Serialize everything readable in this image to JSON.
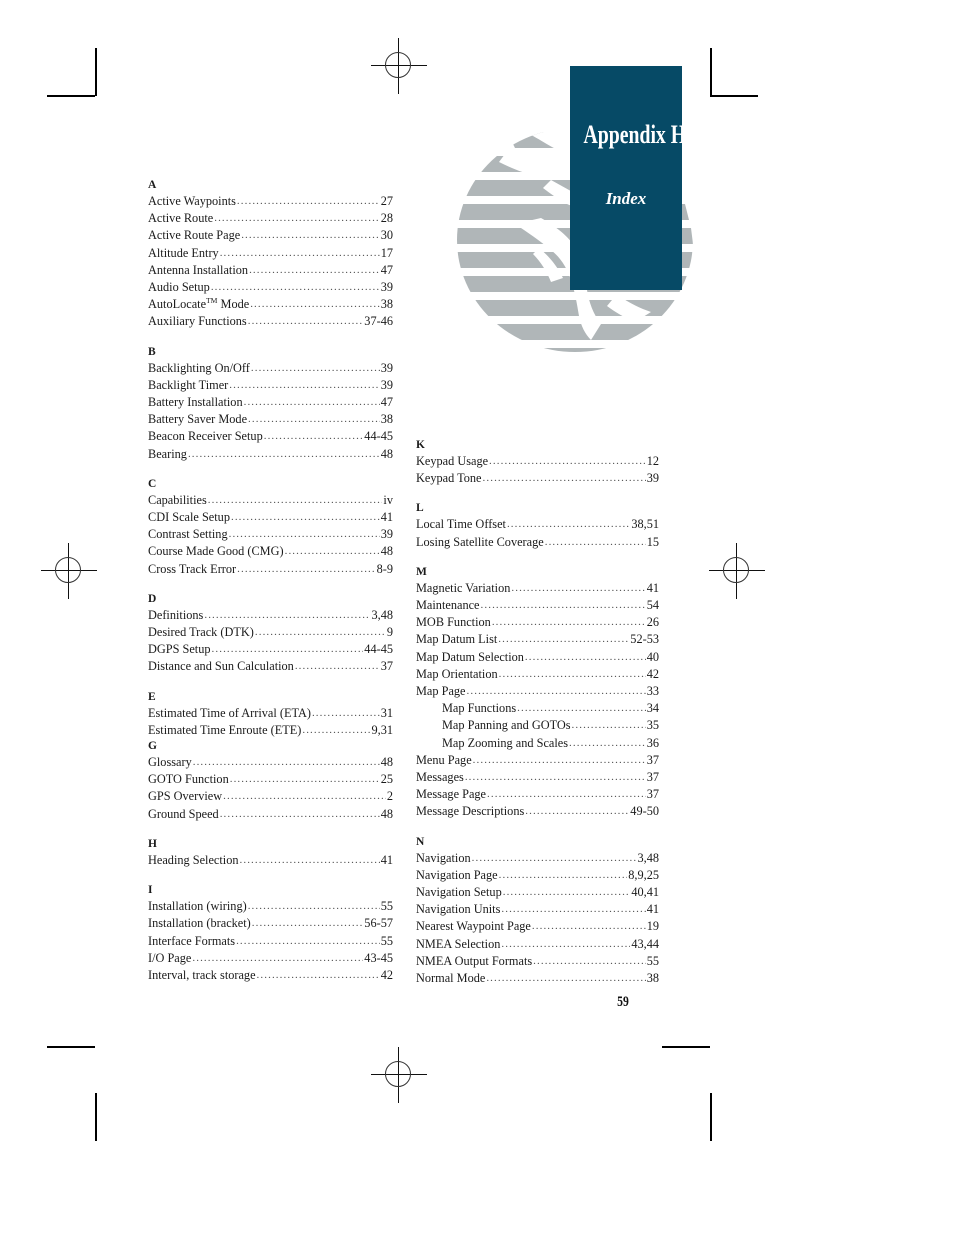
{
  "page": {
    "number": "59",
    "accent_color": "#064a66",
    "globe_color": "#b0b6b8"
  },
  "header": {
    "title": "Appendix H",
    "subtitle": "Index",
    "logo_icon": "globe-icon"
  },
  "marks": {
    "corner_icon": "crop-mark-icon",
    "registration_icon": "registration-target-icon"
  },
  "index": {
    "left_column": [
      {
        "letter": "A",
        "gap_before": false,
        "entries": [
          {
            "label": "Active Waypoints",
            "pages": "27",
            "indent": false
          },
          {
            "label": "Active Route ",
            "pages": "28",
            "indent": false
          },
          {
            "label": "Active Route Page",
            "pages": "30",
            "indent": false
          },
          {
            "label": "Altitude Entry",
            "pages": "17",
            "indent": false
          },
          {
            "label": "Antenna Installation ",
            "pages": "47",
            "indent": false
          },
          {
            "label": "Audio Setup",
            "pages": "39",
            "indent": false
          },
          {
            "label": "AutoLocate",
            "tm": "TM",
            "label_after": " Mode",
            "pages": "38",
            "indent": false
          },
          {
            "label": "Auxiliary Functions ",
            "pages": "37-46",
            "indent": false
          }
        ]
      },
      {
        "letter": "B",
        "gap_before": true,
        "entries": [
          {
            "label": "Backlighting On/Off",
            "pages": "39",
            "indent": false
          },
          {
            "label": "Backlight Timer ",
            "pages": "39",
            "indent": false
          },
          {
            "label": "Battery Installation",
            "pages": "47",
            "indent": false
          },
          {
            "label": "Battery Saver Mode ",
            "pages": "38",
            "indent": false
          },
          {
            "label": "Beacon Receiver Setup",
            "pages": "44-45",
            "indent": false
          },
          {
            "label": "Bearing ",
            "pages": "48",
            "indent": false
          }
        ]
      },
      {
        "letter": "C",
        "gap_before": true,
        "entries": [
          {
            "label": "Capabilities ",
            "pages": "iv",
            "indent": false
          },
          {
            "label": "CDI Scale Setup",
            "pages": "41",
            "indent": false
          },
          {
            "label": "Contrast Setting",
            "pages": "39",
            "indent": false
          },
          {
            "label": "Course Made Good (CMG) ",
            "pages": "48",
            "indent": false
          },
          {
            "label": "Cross Track Error ",
            "pages": "8-9",
            "indent": false
          }
        ]
      },
      {
        "letter": "D",
        "gap_before": true,
        "entries": [
          {
            "label": "Definitions",
            "pages": "3,48",
            "indent": false
          },
          {
            "label": "Desired Track (DTK) ",
            "pages": "9",
            "indent": false
          },
          {
            "label": "DGPS Setup",
            "pages": "44-45",
            "indent": false
          },
          {
            "label": "Distance and Sun Calculation ",
            "pages": "37",
            "indent": false
          }
        ]
      },
      {
        "letter": "E",
        "gap_before": true,
        "entries": [
          {
            "label": "Estimated Time of Arrival (ETA)",
            "pages": "31",
            "indent": false
          },
          {
            "label": "Estimated Time Enroute (ETE) ",
            "pages": "9,31",
            "indent": false
          }
        ]
      },
      {
        "letter": "G",
        "gap_before": false,
        "entries": [
          {
            "label": "Glossary",
            "pages": "48",
            "indent": false
          },
          {
            "label": "GOTO Function ",
            "pages": "25",
            "indent": false
          },
          {
            "label": "GPS Overview ",
            "pages": "2",
            "indent": false
          },
          {
            "label": "Ground Speed ",
            "pages": "48",
            "indent": false
          }
        ]
      },
      {
        "letter": "H",
        "gap_before": true,
        "entries": [
          {
            "label": "Heading Selection ",
            "pages": "41",
            "indent": false
          }
        ]
      },
      {
        "letter": "I",
        "gap_before": true,
        "entries": [
          {
            "label": "Installation (wiring) ",
            "pages": "55",
            "indent": false
          },
          {
            "label": "Installation (bracket) ",
            "pages": "56-57",
            "indent": false
          },
          {
            "label": "Interface Formats",
            "pages": "55",
            "indent": false
          },
          {
            "label": "I/O Page ",
            "pages": "43-45",
            "indent": false
          },
          {
            "label": "Interval, track storage ",
            "pages": "42",
            "indent": false
          }
        ]
      }
    ],
    "right_column": [
      {
        "letter": "K",
        "gap_before": false,
        "entries": [
          {
            "label": "Keypad Usage ",
            "pages": "12",
            "indent": false
          },
          {
            "label": "Keypad Tone ",
            "pages": "39",
            "indent": false
          }
        ]
      },
      {
        "letter": "L",
        "gap_before": true,
        "entries": [
          {
            "label": "Local Time Offset ",
            "pages": "38,51",
            "indent": false
          },
          {
            "label": "Losing Satellite Coverage ",
            "pages": "15",
            "indent": false
          }
        ]
      },
      {
        "letter": "M",
        "gap_before": true,
        "entries": [
          {
            "label": "Magnetic Variation",
            "pages": "41",
            "indent": false
          },
          {
            "label": "Maintenance ",
            "pages": "54",
            "indent": false
          },
          {
            "label": "MOB Function",
            "pages": "26",
            "indent": false
          },
          {
            "label": "Map Datum List ",
            "pages": "52-53",
            "indent": false
          },
          {
            "label": "Map Datum Selection ",
            "pages": "40",
            "indent": false
          },
          {
            "label": "Map Orientation ",
            "pages": "42",
            "indent": false
          },
          {
            "label": "Map Page",
            "pages": "33",
            "indent": false
          },
          {
            "label": "Map Functions ",
            "pages": "34",
            "indent": true
          },
          {
            "label": "Map Panning and GOTOs",
            "pages": "35",
            "indent": true
          },
          {
            "label": "Map Zooming and Scales ",
            "pages": "36",
            "indent": true
          },
          {
            "label": "Menu Page ",
            "pages": "37",
            "indent": false
          },
          {
            "label": "Messages",
            "pages": "37",
            "indent": false
          },
          {
            "label": "Message Page ",
            "pages": "37",
            "indent": false
          },
          {
            "label": "Message Descriptions ",
            "pages": "49-50",
            "indent": false
          }
        ]
      },
      {
        "letter": "N",
        "gap_before": true,
        "entries": [
          {
            "label": "Navigation ",
            "pages": "3,48",
            "indent": false
          },
          {
            "label": "Navigation Page",
            "pages": "8,9,25",
            "indent": false
          },
          {
            "label": "Navigation Setup ",
            "pages": "40,41",
            "indent": false
          },
          {
            "label": "Navigation Units",
            "pages": "41",
            "indent": false
          },
          {
            "label": "Nearest Waypoint Page",
            "pages": "19",
            "indent": false
          },
          {
            "label": "NMEA Selection ",
            "pages": "43,44",
            "indent": false
          },
          {
            "label": "NMEA Output Formats ",
            "pages": "55",
            "indent": false
          },
          {
            "label": "Normal Mode ",
            "pages": "38",
            "indent": false
          }
        ]
      }
    ]
  }
}
